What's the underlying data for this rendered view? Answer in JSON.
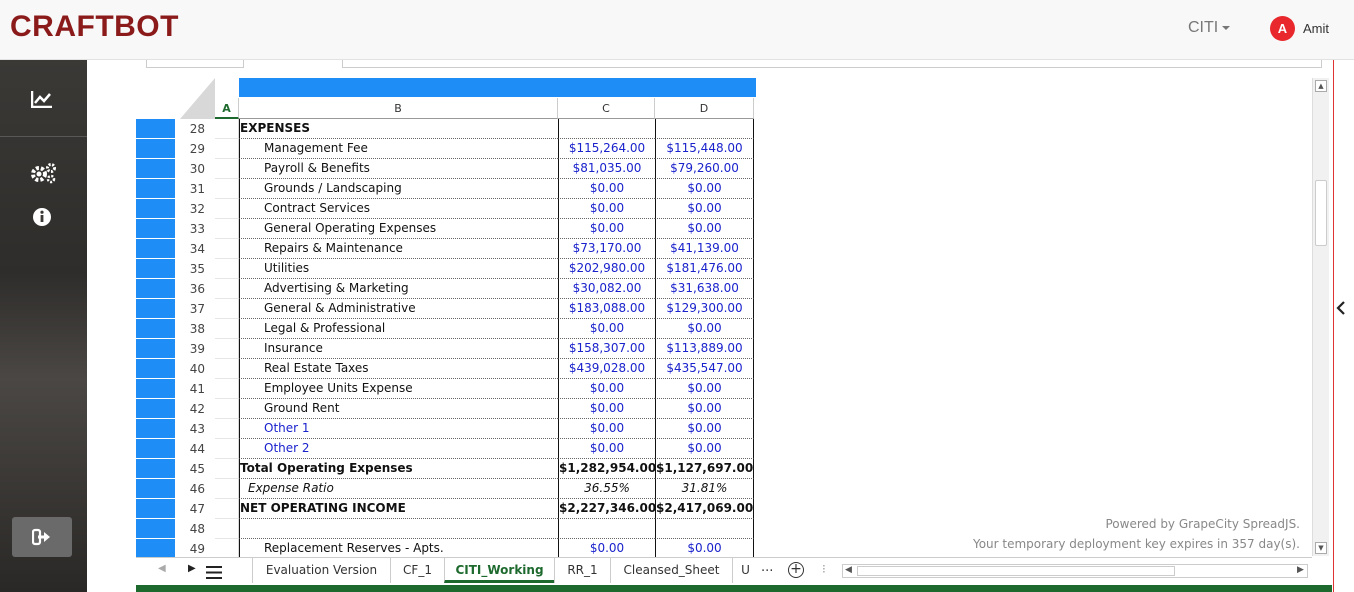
{
  "app": {
    "brand": "CRAFTBOT",
    "org": "CITI",
    "avatar_letter": "A",
    "username": "Amit"
  },
  "icons": {
    "chart": "chart-icon",
    "settings": "gears-icon",
    "info": "info-icon",
    "logout": "logout-icon",
    "collapse": "chevron-left-icon"
  },
  "colors": {
    "brand": "#8b1a1a",
    "selection": "#1e8df5",
    "value_text": "#1a22cc",
    "active_tab": "#1e6a2e"
  },
  "columns": {
    "a": "A",
    "b": "B",
    "c": "C",
    "d": "D"
  },
  "rows": [
    {
      "n": "28",
      "label": "EXPENSES",
      "c": "",
      "d": "",
      "style": "bold"
    },
    {
      "n": "29",
      "label": "Management Fee",
      "c": "$115,264.00",
      "d": "$115,448.00",
      "style": "indent"
    },
    {
      "n": "30",
      "label": "Payroll & Benefits",
      "c": "$81,035.00",
      "d": "$79,260.00",
      "style": "indent"
    },
    {
      "n": "31",
      "label": "Grounds / Landscaping",
      "c": "$0.00",
      "d": "$0.00",
      "style": "indent"
    },
    {
      "n": "32",
      "label": "Contract Services",
      "c": "$0.00",
      "d": "$0.00",
      "style": "indent"
    },
    {
      "n": "33",
      "label": "General Operating Expenses",
      "c": "$0.00",
      "d": "$0.00",
      "style": "indent"
    },
    {
      "n": "34",
      "label": "Repairs & Maintenance",
      "c": "$73,170.00",
      "d": "$41,139.00",
      "style": "indent"
    },
    {
      "n": "35",
      "label": "Utilities",
      "c": "$202,980.00",
      "d": "$181,476.00",
      "style": "indent"
    },
    {
      "n": "36",
      "label": "Advertising & Marketing",
      "c": "$30,082.00",
      "d": "$31,638.00",
      "style": "indent"
    },
    {
      "n": "37",
      "label": "General & Administrative",
      "c": "$183,088.00",
      "d": "$129,300.00",
      "style": "indent"
    },
    {
      "n": "38",
      "label": "Legal & Professional",
      "c": "$0.00",
      "d": "$0.00",
      "style": "indent"
    },
    {
      "n": "39",
      "label": "Insurance",
      "c": "$158,307.00",
      "d": "$113,889.00",
      "style": "indent"
    },
    {
      "n": "40",
      "label": "Real Estate Taxes",
      "c": "$439,028.00",
      "d": "$435,547.00",
      "style": "indent"
    },
    {
      "n": "41",
      "label": "Employee Units Expense",
      "c": "$0.00",
      "d": "$0.00",
      "style": "indent"
    },
    {
      "n": "42",
      "label": "Ground Rent",
      "c": "$0.00",
      "d": "$0.00",
      "style": "indent"
    },
    {
      "n": "43",
      "label": "Other 1",
      "c": "$0.00",
      "d": "$0.00",
      "style": "indent-blue"
    },
    {
      "n": "44",
      "label": "Other 2",
      "c": "$0.00",
      "d": "$0.00",
      "style": "indent-blue"
    },
    {
      "n": "45",
      "label": "Total Operating Expenses",
      "c": "$1,282,954.00",
      "d": "$1,127,697.00",
      "style": "bold"
    },
    {
      "n": "46",
      "label": "Expense Ratio",
      "c": "36.55%",
      "d": "31.81%",
      "style": "italic"
    },
    {
      "n": "47",
      "label": "NET OPERATING INCOME",
      "c": "$2,227,346.00",
      "d": "$2,417,069.00",
      "style": "bold"
    },
    {
      "n": "48",
      "label": "",
      "c": "",
      "d": "",
      "style": "plain"
    },
    {
      "n": "49",
      "label": "Replacement Reserves - Apts.",
      "c": "$0.00",
      "d": "$0.00",
      "style": "indent"
    }
  ],
  "watermark": {
    "line1": "Powered by GrapeCity SpreadJS.",
    "line2": "Your temporary deployment key expires in 357 day(s)."
  },
  "tabs": [
    {
      "label": "Evaluation Version",
      "active": false
    },
    {
      "label": "CF_1",
      "active": false
    },
    {
      "label": "CITI_Working",
      "active": true
    },
    {
      "label": "RR_1",
      "active": false
    },
    {
      "label": "Cleansed_Sheet",
      "active": false
    },
    {
      "label": "U",
      "active": false
    }
  ],
  "tab_controls": {
    "more": "...",
    "add": "+"
  }
}
